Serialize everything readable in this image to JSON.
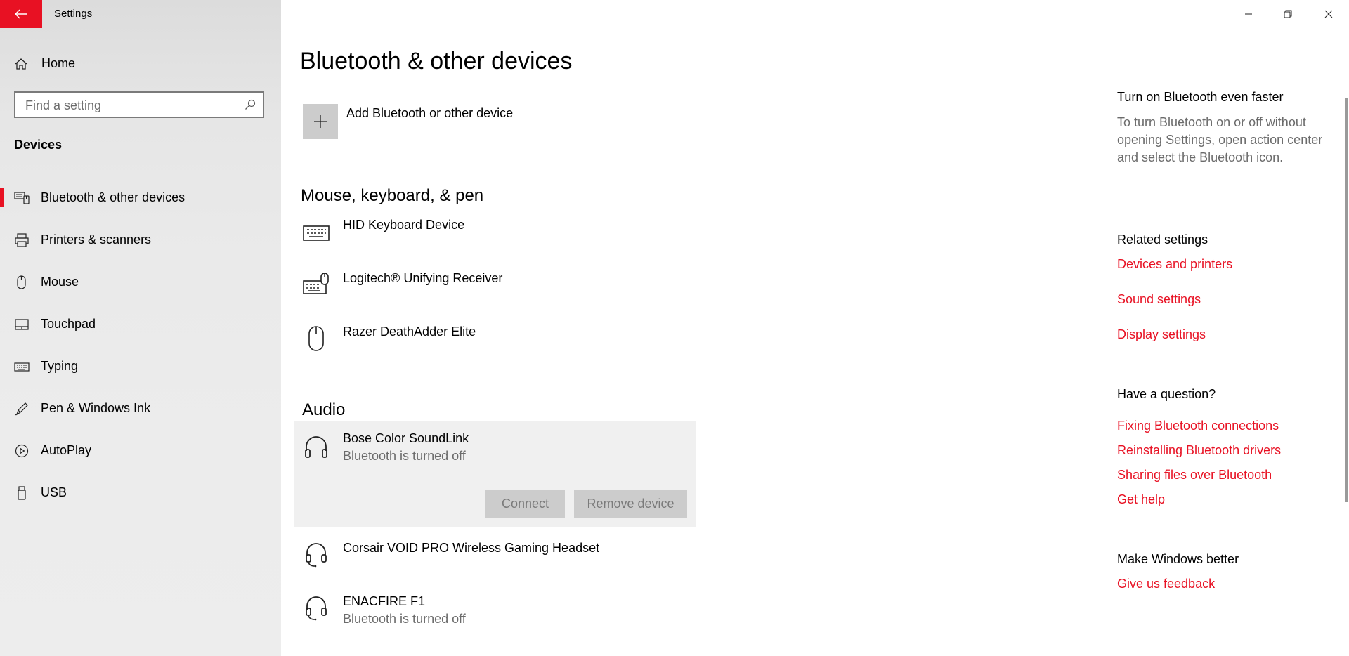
{
  "window": {
    "title": "Settings",
    "controls": {
      "minimize": "minimize",
      "restore": "restore",
      "close": "close"
    }
  },
  "sidebar": {
    "home_label": "Home",
    "search": {
      "placeholder": "Find a setting",
      "value": ""
    },
    "section_label": "Devices",
    "items": [
      {
        "label": "Bluetooth & other devices",
        "icon": "bluetooth-devices-icon",
        "selected": true
      },
      {
        "label": "Printers & scanners",
        "icon": "printer-icon",
        "selected": false
      },
      {
        "label": "Mouse",
        "icon": "mouse-icon",
        "selected": false
      },
      {
        "label": "Touchpad",
        "icon": "touchpad-icon",
        "selected": false
      },
      {
        "label": "Typing",
        "icon": "keyboard-icon",
        "selected": false
      },
      {
        "label": "Pen & Windows Ink",
        "icon": "pen-icon",
        "selected": false
      },
      {
        "label": "AutoPlay",
        "icon": "autoplay-icon",
        "selected": false
      },
      {
        "label": "USB",
        "icon": "usb-icon",
        "selected": false
      }
    ]
  },
  "main": {
    "title": "Bluetooth & other devices",
    "add_device_label": "Add Bluetooth or other device",
    "groups": {
      "input": {
        "heading": "Mouse, keyboard, & pen",
        "devices": [
          {
            "name": "HID Keyboard Device",
            "icon": "keyboard-icon"
          },
          {
            "name": "Logitech® Unifying Receiver",
            "icon": "keyboard-mouse-icon"
          },
          {
            "name": "Razer DeathAdder Elite",
            "icon": "mouse-icon"
          }
        ]
      },
      "audio": {
        "heading": "Audio",
        "devices": [
          {
            "name": "Bose Color SoundLink",
            "status": "Bluetooth is turned off",
            "icon": "headphones-icon",
            "selected": true
          },
          {
            "name": "Corsair VOID PRO Wireless Gaming Headset",
            "icon": "headset-icon"
          },
          {
            "name": "ENACFIRE F1",
            "status": "Bluetooth is turned off",
            "icon": "headset-icon"
          }
        ],
        "connect_label": "Connect",
        "remove_label": "Remove device"
      }
    }
  },
  "right": {
    "tip": {
      "heading": "Turn on Bluetooth even faster",
      "text": "To turn Bluetooth on or off without opening Settings, open action center and select the Bluetooth icon."
    },
    "related": {
      "heading": "Related settings",
      "links": [
        "Devices and printers",
        "Sound settings",
        "Display settings"
      ]
    },
    "question": {
      "heading": "Have a question?",
      "links": [
        "Fixing Bluetooth connections",
        "Reinstalling Bluetooth drivers",
        "Sharing files over Bluetooth",
        "Get help"
      ]
    },
    "feedback": {
      "heading": "Make Windows better",
      "link": "Give us feedback"
    }
  },
  "colors": {
    "accent": "#e81123",
    "sidebar_bg": "#e6e6e6",
    "secondary_text": "#6b6b6b",
    "button_bg": "#cccccc"
  }
}
